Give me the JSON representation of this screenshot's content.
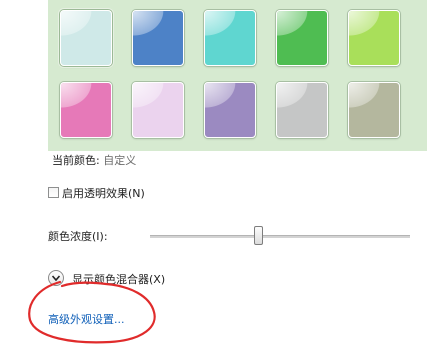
{
  "swatches": {
    "row1": [
      {
        "color": "#cfe9e8"
      },
      {
        "color": "#4d82c7"
      },
      {
        "color": "#5fd6d0"
      },
      {
        "color": "#4fbd52"
      },
      {
        "color": "#a9df5a"
      }
    ],
    "row2": [
      {
        "color": "#e679b8"
      },
      {
        "color": "#ebd3ee"
      },
      {
        "color": "#9b8ac1"
      },
      {
        "color": "#c5c6c6"
      },
      {
        "color": "#b4b79e"
      }
    ]
  },
  "current_color": {
    "label": "当前颜色:",
    "value": "自定义"
  },
  "transparency": {
    "label": "启用透明效果(N)",
    "checked": false
  },
  "intensity": {
    "label": "颜色浓度(I):",
    "level_percent": 42
  },
  "mixer": {
    "label": "显示颜色混合器(X)"
  },
  "advanced_link": {
    "label": "高级外观设置..."
  },
  "annotation": {
    "color": "#e02b2b"
  }
}
